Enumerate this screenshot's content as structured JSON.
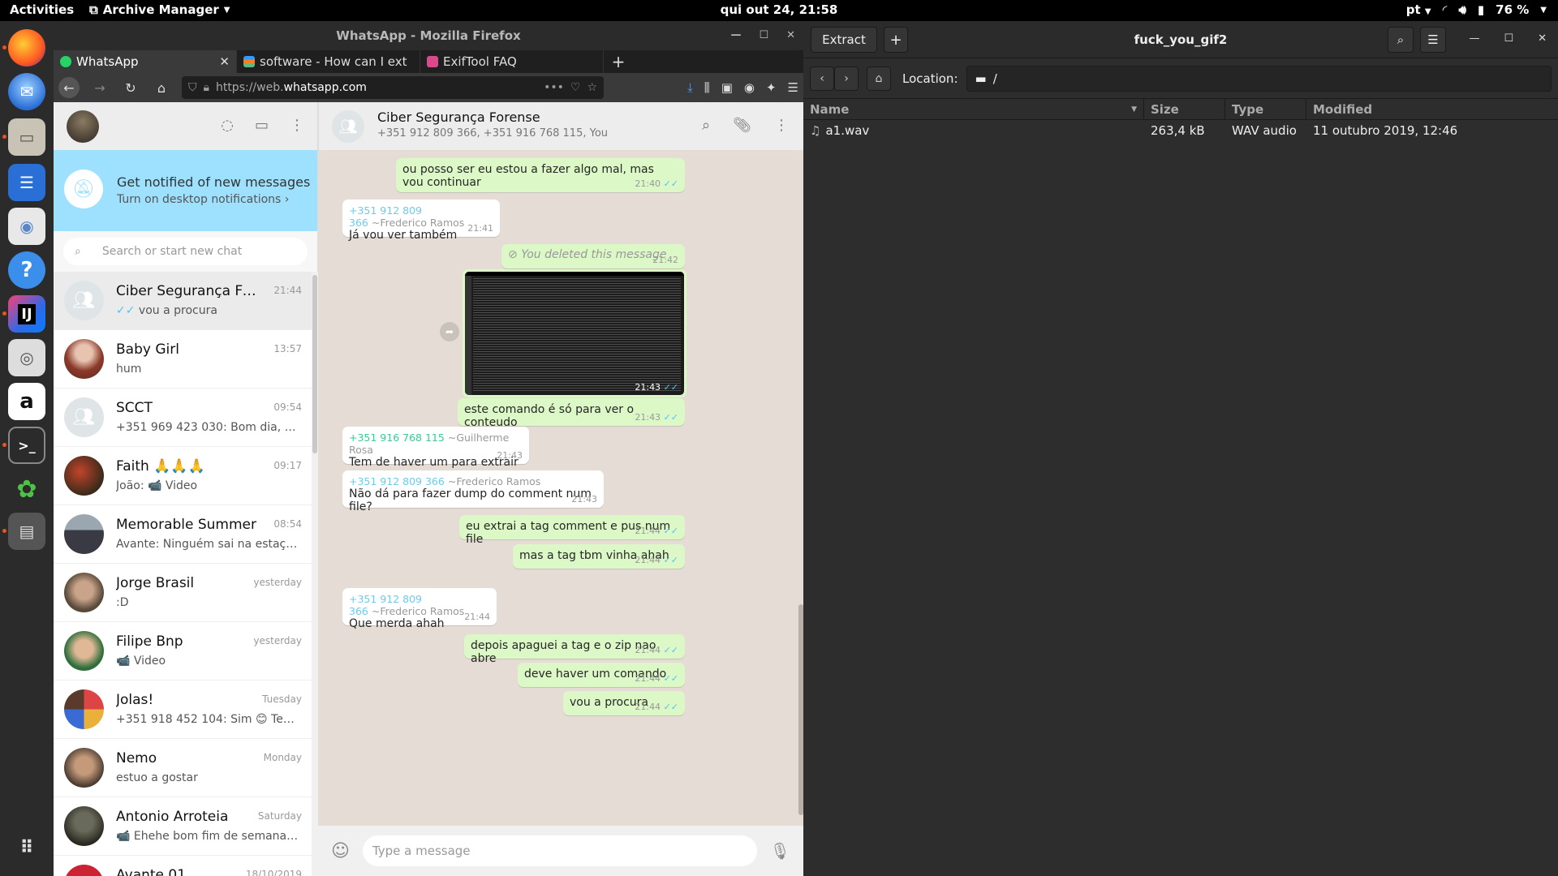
{
  "topbar": {
    "activities": "Activities",
    "app_menu": "Archive Manager",
    "clock": "qui out 24, 21:58",
    "lang": "pt",
    "battery": "76 %"
  },
  "firefox": {
    "window_title": "WhatsApp - Mozilla Firefox",
    "tabs": [
      {
        "label": "WhatsApp",
        "fav_color": "#25d366"
      },
      {
        "label": "software - How can I ext",
        "fav_color": "#f48024"
      },
      {
        "label": "ExifTool FAQ",
        "fav_color": "#d94a8c"
      }
    ],
    "url_prefix": "https://web.",
    "url_domain": "whatsapp.com",
    "url_suffix": ""
  },
  "whatsapp": {
    "notify_title": "Get notified of new messages",
    "notify_sub": "Turn on desktop notifications ›",
    "search_placeholder": "Search or start new chat",
    "chats": [
      {
        "name": "Ciber Segurança Forense",
        "time": "21:44",
        "last": "vou a procura",
        "ticks": "✓✓"
      },
      {
        "name": "Baby Girl",
        "time": "13:57",
        "last": "hum"
      },
      {
        "name": "SCCT",
        "time": "09:54",
        "last": "+351 969 423 030: Bom dia, ch…"
      },
      {
        "name": "Faith 🙏🙏🙏",
        "time": "09:17",
        "last": "João: 📹 Video"
      },
      {
        "name": "Memorable Summer",
        "time": "08:54",
        "last": "Avante: Ninguém sai na estaçã…"
      },
      {
        "name": "Jorge Brasil",
        "time": "yesterday",
        "last": ":D"
      },
      {
        "name": "Filipe Bnp",
        "time": "yesterday",
        "last": "📹 Video"
      },
      {
        "name": "Jolas!",
        "time": "Tuesday",
        "last": "+351 918 452 104: Sim 😊 Ten…"
      },
      {
        "name": "Nemo",
        "time": "Monday",
        "last": "estuo a gostar"
      },
      {
        "name": "Antonio Arroteia",
        "time": "Saturday",
        "last": "📹 Ehehe bom fim de semana …"
      },
      {
        "name": "Avante 01",
        "time": "18/10/2019",
        "last": ""
      }
    ],
    "conversation": {
      "title": "Ciber Segurança Forense",
      "subtitle": "+351 912 809 366, +351 916 768 115, You",
      "messages": [
        {
          "text": "ou posso ser eu estou a fazer algo mal, mas vou continuar",
          "time": "21:40"
        },
        {
          "author": "+351 912 809 366",
          "nick": "~Frederico Ramos",
          "text": "Já vou ver também",
          "time": "21:41"
        },
        {
          "text": "You deleted this message",
          "time": "21:42"
        },
        {
          "time": "21:43"
        },
        {
          "text": "este comando é só para ver o conteudo",
          "time": "21:43"
        },
        {
          "author": "+351 916 768 115",
          "nick": "~Guilherme Rosa",
          "text": "Tem de haver um para extrair",
          "time": "21:43"
        },
        {
          "author": "+351 912 809 366",
          "nick": "~Frederico Ramos",
          "text": "Não dá para fazer dump do comment num file?",
          "time": "21:43"
        },
        {
          "text": "eu extrai a tag comment e pus num file",
          "time": "21:44"
        },
        {
          "text": "mas a tag tbm vinha ahah",
          "time": "21:44"
        },
        {
          "author": "+351 912 809 366",
          "nick": "~Frederico Ramos",
          "text": "Que merda ahah",
          "time": "21:44"
        },
        {
          "text": "depois apaguei a tag e o zip nao abre",
          "time": "21:44"
        },
        {
          "text": "deve haver um comando",
          "time": "21:44"
        },
        {
          "text": "vou a procura",
          "time": "21:44"
        }
      ],
      "composer_placeholder": "Type a message"
    }
  },
  "archive": {
    "extract_label": "Extract",
    "title": "fuck_you_gif2",
    "location_label": "Location:",
    "location_path": "/",
    "columns": [
      "Name",
      "Size",
      "Type",
      "Modified"
    ],
    "rows": [
      {
        "name": "a1.wav",
        "size": "263,4 kB",
        "type": "WAV audio",
        "modified": "11 outubro 2019, 12:46"
      }
    ]
  }
}
